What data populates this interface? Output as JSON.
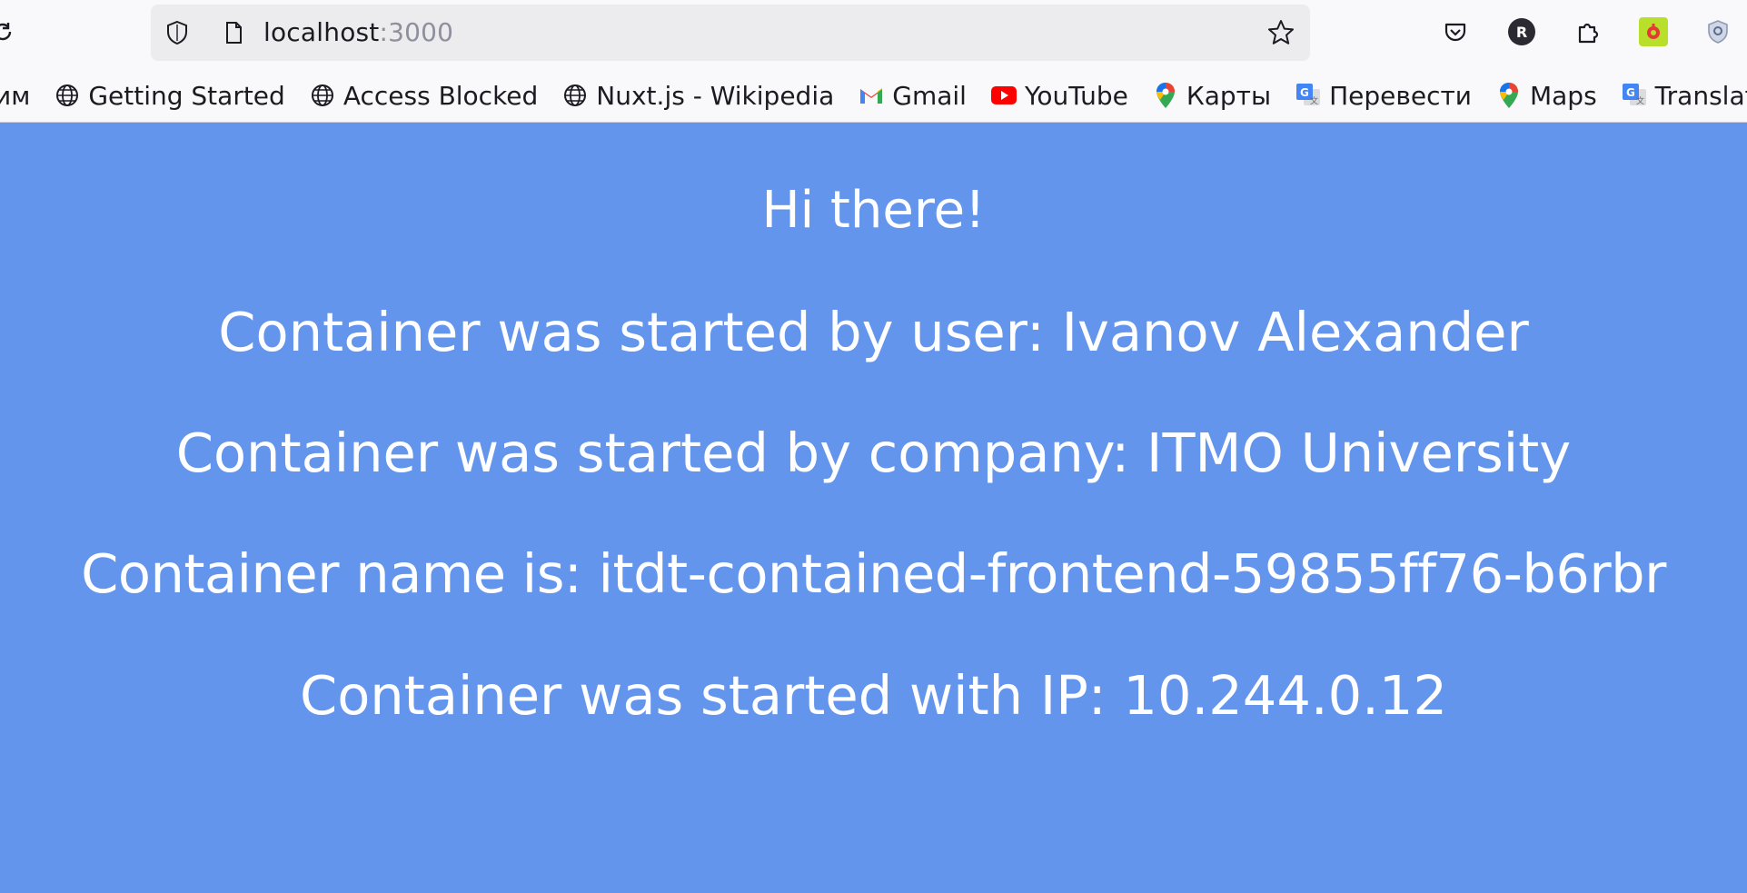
{
  "browser": {
    "url_host": "localhost",
    "url_port": ":3000",
    "profile_initial": "R"
  },
  "bookmarks": [
    {
      "label": "им",
      "icon": "none"
    },
    {
      "label": "Getting Started",
      "icon": "globe-icon"
    },
    {
      "label": "Access Blocked",
      "icon": "globe-icon"
    },
    {
      "label": "Nuxt.js - Wikipedia",
      "icon": "globe-icon"
    },
    {
      "label": "Gmail",
      "icon": "gmail-icon"
    },
    {
      "label": "YouTube",
      "icon": "youtube-icon"
    },
    {
      "label": "Карты",
      "icon": "maps-pin-icon"
    },
    {
      "label": "Перевести",
      "icon": "translate-icon"
    },
    {
      "label": "Maps",
      "icon": "maps-pin-icon"
    },
    {
      "label": "Translate",
      "icon": "translate-icon"
    }
  ],
  "page": {
    "background": "#6495ed",
    "greeting": "Hi there!",
    "user_line": "Container was started by user: Ivanov Alexander",
    "company_line": "Container was started by company: ITMO University",
    "name_line": "Container name is: itdt-contained-frontend-59855ff76-b6rbr",
    "ip_line": "Container was started with IP: 10.244.0.12"
  }
}
